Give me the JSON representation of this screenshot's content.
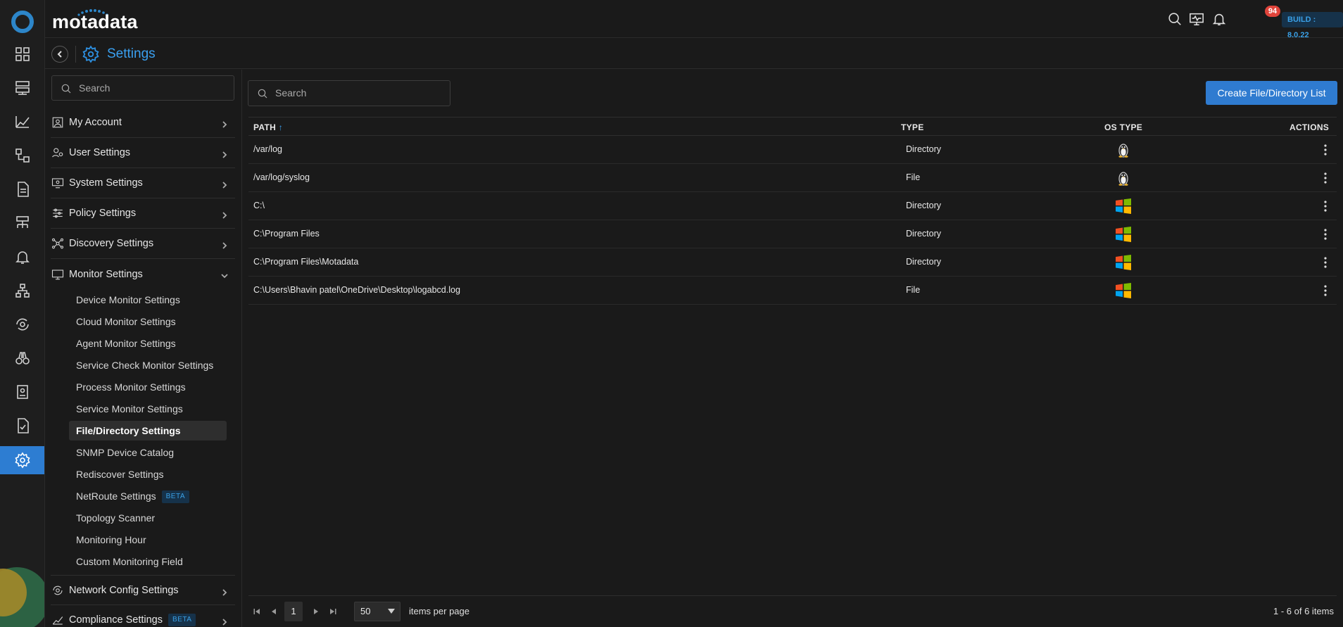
{
  "app": {
    "brand": "motadata",
    "build": "BUILD : 8.0.22",
    "notifications": "94"
  },
  "header": {
    "title": "Settings"
  },
  "sidebar": {
    "search_placeholder": "Search",
    "groups": [
      {
        "label": "My Account",
        "icon": "account-icon"
      },
      {
        "label": "User Settings",
        "icon": "user-settings-icon"
      },
      {
        "label": "System Settings",
        "icon": "system-settings-icon"
      },
      {
        "label": "Policy Settings",
        "icon": "sliders-icon"
      },
      {
        "label": "Discovery Settings",
        "icon": "discovery-icon"
      },
      {
        "label": "Monitor Settings",
        "icon": "monitor-icon",
        "expanded": true
      },
      {
        "label": "Network Config Settings",
        "icon": "network-config-icon"
      },
      {
        "label": "Compliance Settings",
        "icon": "compliance-icon",
        "badge": "BETA"
      }
    ],
    "monitor_items": [
      {
        "label": "Device Monitor Settings"
      },
      {
        "label": "Cloud Monitor Settings"
      },
      {
        "label": "Agent Monitor Settings"
      },
      {
        "label": "Service Check Monitor Settings"
      },
      {
        "label": "Process Monitor Settings"
      },
      {
        "label": "Service Monitor Settings"
      },
      {
        "label": "File/Directory Settings",
        "active": true
      },
      {
        "label": "SNMP Device Catalog"
      },
      {
        "label": "Rediscover Settings"
      },
      {
        "label": "NetRoute Settings",
        "badge": "BETA"
      },
      {
        "label": "Topology Scanner"
      },
      {
        "label": "Monitoring Hour"
      },
      {
        "label": "Custom Monitoring Field"
      }
    ]
  },
  "main": {
    "search_placeholder": "Search",
    "create_button": "Create File/Directory List",
    "columns": {
      "path": "PATH",
      "sort_indicator": "↑",
      "type": "TYPE",
      "os_type": "OS TYPE",
      "actions": "ACTIONS"
    },
    "rows": [
      {
        "path": "/var/log",
        "type": "Directory",
        "os": "linux-icon"
      },
      {
        "path": "/var/log/syslog",
        "type": "File",
        "os": "linux-icon"
      },
      {
        "path": "C:\\",
        "type": "Directory",
        "os": "windows-icon"
      },
      {
        "path": "C:\\Program Files",
        "type": "Directory",
        "os": "windows-icon"
      },
      {
        "path": "C:\\Program Files\\Motadata",
        "type": "Directory",
        "os": "windows-icon"
      },
      {
        "path": "C:\\Users\\Bhavin patel\\OneDrive\\Desktop\\logabcd.log",
        "type": "File",
        "os": "windows-icon"
      }
    ],
    "pagination": {
      "page": "1",
      "per_page": "50",
      "per_page_label": "items per page",
      "info": "1 - 6 of 6 items"
    }
  },
  "colors": {
    "accent": "#2f7bd0",
    "background": "#1a1a1a",
    "badge_red": "#e0443b"
  }
}
